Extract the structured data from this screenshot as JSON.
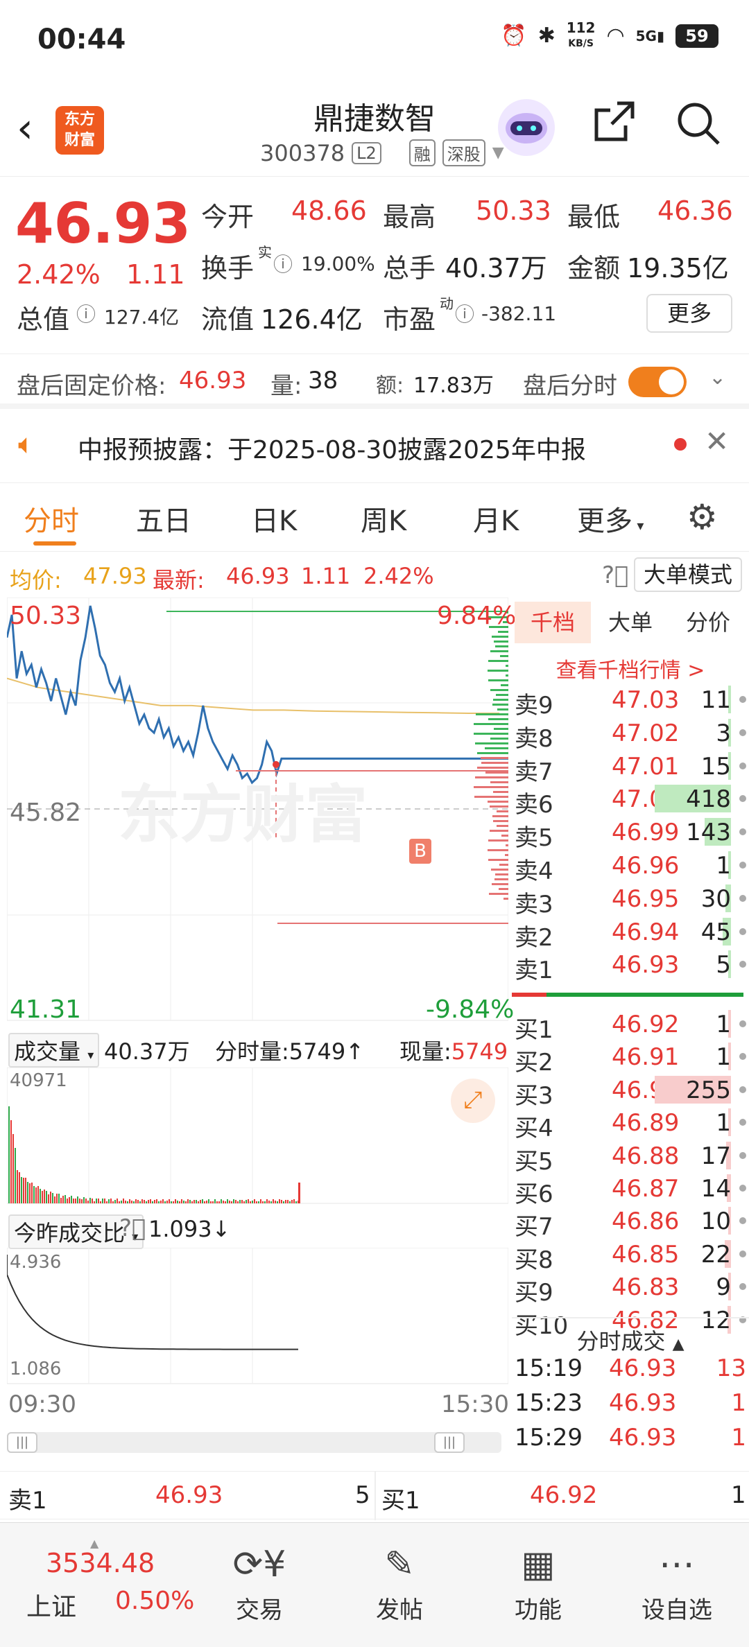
{
  "status": {
    "time": "00:44",
    "net_speed": "112",
    "net_unit": "KB/S",
    "signal": "5G",
    "battery": "59"
  },
  "header": {
    "title": "鼎捷数智",
    "code": "300378",
    "level_tag": "L2",
    "tag_rong": "融",
    "tag_market": "深股",
    "logo_text": "东方财富"
  },
  "quote": {
    "price": "46.93",
    "pct": "2.42%",
    "change": "1.11",
    "open_label": "今开",
    "open": "48.66",
    "high_label": "最高",
    "high": "50.33",
    "low_label": "最低",
    "low": "46.36",
    "turnover_label": "换手",
    "turnover_sup": "实",
    "turnover": "19.00%",
    "volume_label": "总手",
    "volume": "40.37万",
    "amount_label": "金额",
    "amount": "19.35亿",
    "mcap_label": "总值",
    "mcap": "127.4亿",
    "float_label": "流值",
    "float": "126.4亿",
    "pe_label": "市盈",
    "pe_sup": "动",
    "pe": "-382.11",
    "more_btn": "更多"
  },
  "after_hours": {
    "label": "盘后固定价格:",
    "price": "46.93",
    "vol_label": "量:",
    "vol": "38",
    "amt_label": "额:",
    "amt": "17.83万",
    "switch_label": "盘后分时"
  },
  "notice": {
    "text": "中报预披露：于2025-08-30披露2025年中报"
  },
  "tabs": [
    "分时",
    "五日",
    "日K",
    "周K",
    "月K",
    "更多"
  ],
  "avg": {
    "avg_label": "均价:",
    "avg": "47.93",
    "last_label": "最新:",
    "last": "46.93",
    "chg": "1.11",
    "pct": "2.42%",
    "big_order_btn": "大单模式"
  },
  "chart_data": {
    "type": "line",
    "y_max": "50.33",
    "y_min": "41.31",
    "y_mid": "45.82",
    "pct_max": "9.84%",
    "pct_min": "-9.84%",
    "watermark": "东方财富",
    "marker": "B",
    "x_start": "09:30",
    "x_end": "15:30",
    "ylim": [
      41.31,
      50.33
    ],
    "price_series": [
      49.6,
      50.1,
      48.7,
      49.3,
      48.8,
      49.0,
      48.5,
      48.9,
      48.6,
      48.2,
      48.7,
      48.3,
      47.9,
      48.4,
      48.1,
      49.1,
      49.6,
      50.3,
      49.8,
      49.2,
      49.0,
      48.6,
      48.4,
      48.7,
      48.2,
      48.5,
      48.1,
      47.7,
      47.9,
      47.6,
      47.5,
      47.8,
      47.4,
      47.6,
      47.2,
      47.4,
      47.1,
      47.3,
      47.0,
      47.5,
      48.1,
      47.6,
      47.3,
      47.1,
      46.9,
      46.7,
      47.0,
      46.8,
      46.5,
      46.6,
      46.4,
      46.5,
      46.8,
      47.3,
      47.1,
      46.6,
      46.93,
      46.93,
      46.93
    ],
    "avg_series": [
      48.7,
      48.5,
      48.4,
      48.3,
      48.2,
      48.1,
      48.1,
      48.05,
      48.0,
      48.0,
      47.98,
      47.97,
      47.96,
      47.95,
      47.94,
      47.93,
      47.93
    ]
  },
  "book": {
    "tabs": [
      "千档",
      "大单",
      "分价"
    ],
    "link": "查看千档行情 >",
    "asks": [
      {
        "label": "卖9",
        "price": "47.03",
        "qty": "11"
      },
      {
        "label": "卖8",
        "price": "47.02",
        "qty": "3"
      },
      {
        "label": "卖7",
        "price": "47.01",
        "qty": "15"
      },
      {
        "label": "卖6",
        "price": "47.00",
        "qty": "418"
      },
      {
        "label": "卖5",
        "price": "46.99",
        "qty": "143"
      },
      {
        "label": "卖4",
        "price": "46.96",
        "qty": "1"
      },
      {
        "label": "卖3",
        "price": "46.95",
        "qty": "30"
      },
      {
        "label": "卖2",
        "price": "46.94",
        "qty": "45"
      },
      {
        "label": "卖1",
        "price": "46.93",
        "qty": "5"
      }
    ],
    "bids": [
      {
        "label": "买1",
        "price": "46.92",
        "qty": "1"
      },
      {
        "label": "买2",
        "price": "46.91",
        "qty": "1"
      },
      {
        "label": "买3",
        "price": "46.90",
        "qty": "255"
      },
      {
        "label": "买4",
        "price": "46.89",
        "qty": "1"
      },
      {
        "label": "买5",
        "price": "46.88",
        "qty": "17"
      },
      {
        "label": "买6",
        "price": "46.87",
        "qty": "14"
      },
      {
        "label": "买7",
        "price": "46.86",
        "qty": "10"
      },
      {
        "label": "买8",
        "price": "46.85",
        "qty": "22"
      },
      {
        "label": "买9",
        "price": "46.83",
        "qty": "9"
      },
      {
        "label": "买10",
        "price": "46.82",
        "qty": "12"
      }
    ],
    "ticks_title": "分时成交",
    "ticks": [
      {
        "time": "15:19",
        "price": "46.93",
        "qty": "13"
      },
      {
        "time": "15:23",
        "price": "46.93",
        "qty": "1"
      },
      {
        "time": "15:29",
        "price": "46.93",
        "qty": "1"
      }
    ]
  },
  "volume": {
    "label": "成交量",
    "total": "40.37万",
    "tick_label": "分时量:5749↑",
    "now_label": "现量:",
    "now": "5749",
    "max": "40971"
  },
  "ratio": {
    "label": "今昨成交比",
    "value": "1.093↓",
    "max": "4.936",
    "min": "1.086"
  },
  "bottom_bar": {
    "ask_label": "卖1",
    "ask_price": "46.93",
    "ask_qty": "5",
    "bid_label": "买1",
    "bid_price": "46.92",
    "bid_qty": "1"
  },
  "nav": {
    "index_value": "3534.48",
    "index_name": "上证",
    "index_pct": "0.50%",
    "items": [
      "交易",
      "发帖",
      "功能",
      "设自选"
    ]
  }
}
